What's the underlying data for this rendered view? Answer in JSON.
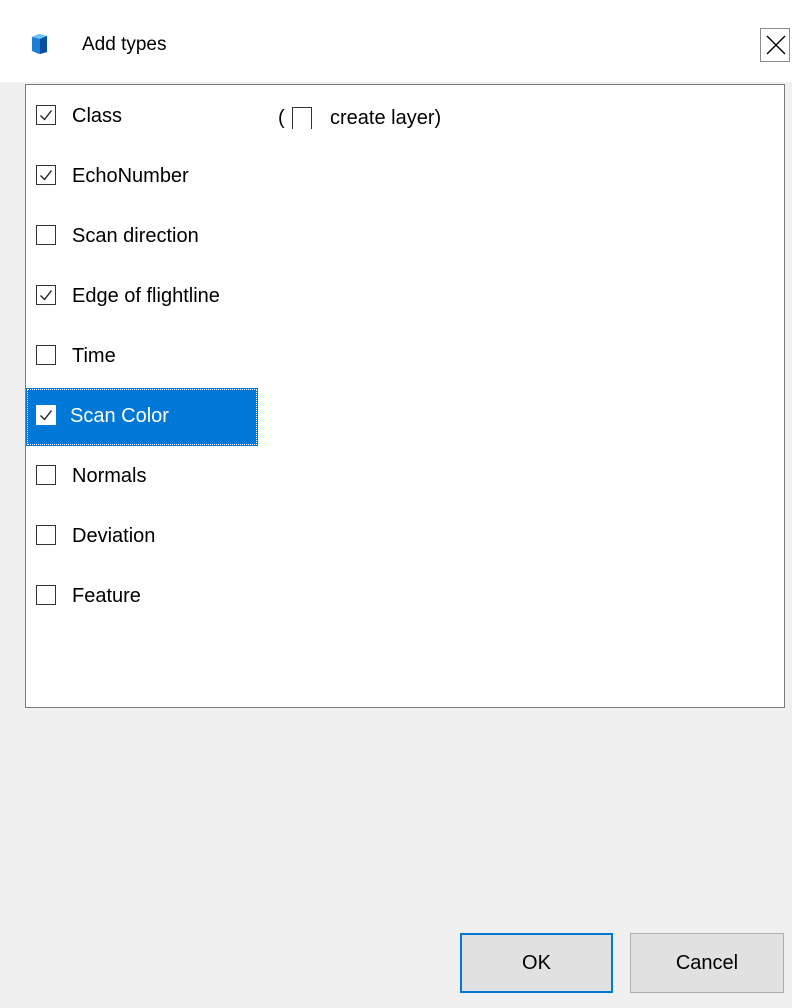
{
  "window": {
    "title": "Add types",
    "app_icon": "app-cube-icon",
    "close_icon": "close-icon"
  },
  "list": {
    "items": [
      {
        "label": "Class",
        "checked": true,
        "selected": false
      },
      {
        "label": "EchoNumber",
        "checked": true,
        "selected": false
      },
      {
        "label": "Scan direction",
        "checked": false,
        "selected": false
      },
      {
        "label": "Edge of flightline",
        "checked": true,
        "selected": false
      },
      {
        "label": "Time",
        "checked": false,
        "selected": false
      },
      {
        "label": "Scan Color",
        "checked": true,
        "selected": true
      },
      {
        "label": "Normals",
        "checked": false,
        "selected": false
      },
      {
        "label": "Deviation",
        "checked": false,
        "selected": false
      },
      {
        "label": "Feature",
        "checked": false,
        "selected": false
      }
    ],
    "create_layer": {
      "open_paren": "(",
      "label": "create layer)",
      "checked": false
    }
  },
  "buttons": {
    "ok": "OK",
    "cancel": "Cancel"
  },
  "colors": {
    "selection": "#0078d7",
    "background": "#f0f0f0"
  }
}
